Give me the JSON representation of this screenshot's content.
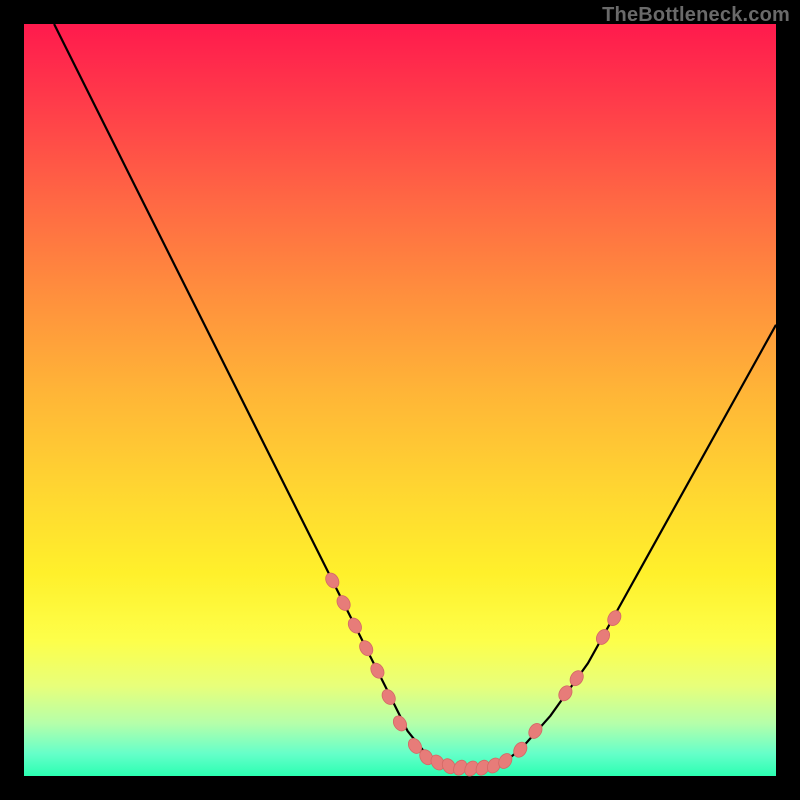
{
  "watermark": "TheBottleneck.com",
  "colors": {
    "background": "#000000",
    "curve_stroke": "#000000",
    "marker_fill": "#e77c79",
    "marker_stroke": "#d36865"
  },
  "chart_data": {
    "type": "line",
    "title": "",
    "xlabel": "",
    "ylabel": "",
    "xlim": [
      0,
      100
    ],
    "ylim": [
      0,
      100
    ],
    "grid": false,
    "legend": false,
    "series": [
      {
        "name": "curve",
        "x": [
          4,
          8,
          12,
          16,
          20,
          24,
          28,
          32,
          36,
          40,
          44,
          46,
          48,
          49.5,
          51,
          53,
          55,
          57,
          59,
          62,
          64,
          66,
          70,
          75,
          80,
          85,
          90,
          95,
          100
        ],
        "y": [
          100,
          92,
          84,
          76,
          68,
          60,
          52,
          44,
          36,
          28,
          20,
          16,
          12,
          9,
          6,
          3.5,
          2,
          1.2,
          1,
          1.2,
          2,
          3.5,
          8,
          15,
          24,
          33,
          42,
          51,
          60
        ]
      }
    ],
    "markers": [
      {
        "x": 41,
        "y": 26
      },
      {
        "x": 42.5,
        "y": 23
      },
      {
        "x": 44,
        "y": 20
      },
      {
        "x": 45.5,
        "y": 17
      },
      {
        "x": 47,
        "y": 14
      },
      {
        "x": 48.5,
        "y": 10.5
      },
      {
        "x": 50,
        "y": 7
      },
      {
        "x": 52,
        "y": 4
      },
      {
        "x": 53.5,
        "y": 2.5
      },
      {
        "x": 55,
        "y": 1.8
      },
      {
        "x": 56.5,
        "y": 1.3
      },
      {
        "x": 58,
        "y": 1.1
      },
      {
        "x": 59.5,
        "y": 1
      },
      {
        "x": 61,
        "y": 1.1
      },
      {
        "x": 62.5,
        "y": 1.4
      },
      {
        "x": 64,
        "y": 2
      },
      {
        "x": 66,
        "y": 3.5
      },
      {
        "x": 68,
        "y": 6
      },
      {
        "x": 72,
        "y": 11
      },
      {
        "x": 73.5,
        "y": 13
      },
      {
        "x": 77,
        "y": 18.5
      },
      {
        "x": 78.5,
        "y": 21
      }
    ]
  }
}
